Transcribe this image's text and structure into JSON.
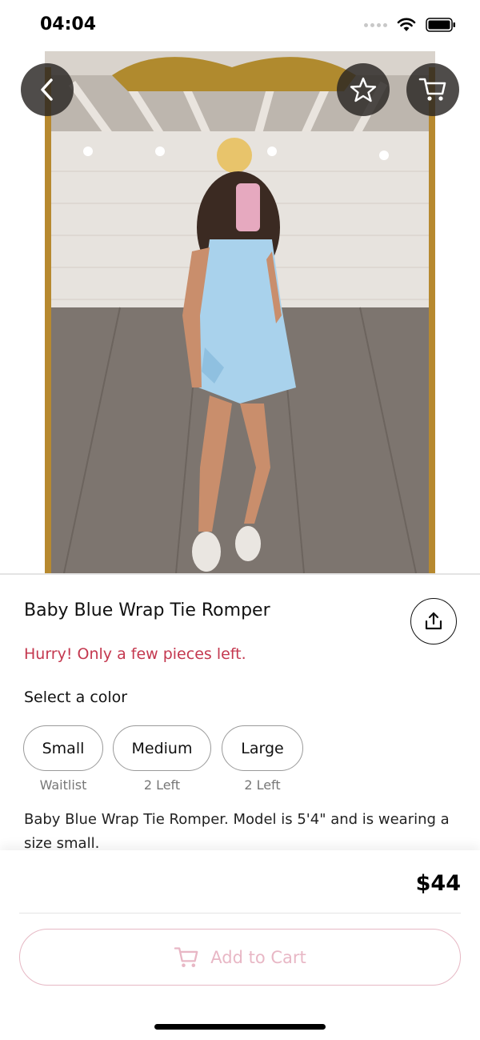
{
  "status_bar": {
    "time": "04:04",
    "icons": [
      "signal-dots-icon",
      "wifi-icon",
      "battery-icon"
    ]
  },
  "hero": {
    "image_description": "product photo",
    "pager": {
      "count": 2,
      "active_index": 1,
      "active_color": "#e4aabb",
      "inactive_color": "#c6c6c6"
    },
    "buttons": {
      "back_icon": "chevron-left-icon",
      "favorite_icon": "star-outline-icon",
      "cart_icon": "cart-icon"
    }
  },
  "product": {
    "title": "Baby Blue Wrap Tie Romper",
    "urgency_text": "Hurry! Only a few pieces left.",
    "select_label": "Select a color",
    "options": [
      {
        "label": "Small",
        "stock": "Waitlist"
      },
      {
        "label": "Medium",
        "stock": "2 Left"
      },
      {
        "label": "Large",
        "stock": "2 Left"
      }
    ],
    "description": "Baby Blue Wrap Tie Romper. Model is 5'4\" and is wearing a size small."
  },
  "purchase": {
    "price": "$44",
    "add_to_cart_label": "Add to Cart"
  },
  "colors": {
    "urgency": "#c4384f",
    "cart_accent": "#e8b7c5",
    "icon_button_bg": "#2d2926"
  }
}
